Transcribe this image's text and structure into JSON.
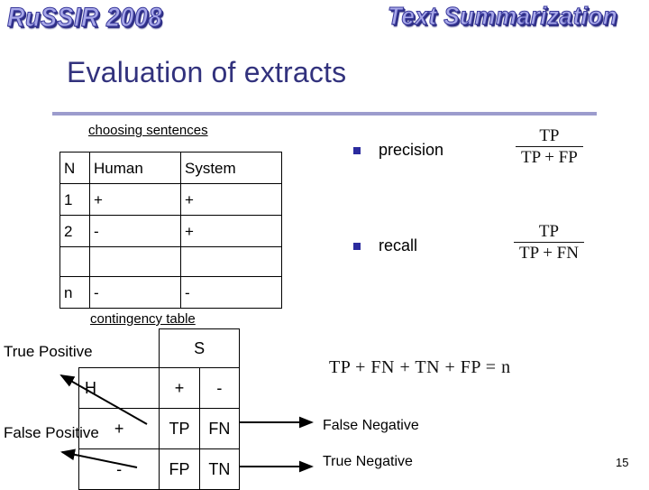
{
  "banner": {
    "left_text": "RuSSIR 2008",
    "right_text": "Text Summarization",
    "color": "#3a3a9c"
  },
  "title": {
    "text": "Evaluation of extracts",
    "color": "#32327d",
    "rule_color": "#9c9ccd"
  },
  "captions": {
    "choosing_sentences": "choosing sentences",
    "contingency_table": "contingency table"
  },
  "sentences_table": {
    "headers": [
      "N",
      "Human",
      "System"
    ],
    "rows": [
      [
        "1",
        "+",
        "+"
      ],
      [
        "2",
        "-",
        "+"
      ],
      [
        "",
        "",
        ""
      ],
      [
        "n",
        "-",
        "-"
      ]
    ]
  },
  "contingency_table": {
    "corner": "",
    "system_header": "S",
    "human_header": "H",
    "system_values": [
      "+",
      "-"
    ],
    "human_values": [
      "+",
      "-"
    ],
    "cells": [
      [
        "TP",
        "FN"
      ],
      [
        "FP",
        "TN"
      ]
    ]
  },
  "callouts": {
    "true_positive": "True Positive",
    "false_positive": "False Positive",
    "false_negative": "False Negative",
    "true_negative": "True Negative"
  },
  "metrics": [
    {
      "label": "precision",
      "numerator": "TP",
      "denominator": "TP + FP",
      "bullet_color": "#2b2b9e"
    },
    {
      "label": "recall",
      "numerator": "TP",
      "denominator": "TP + FN",
      "bullet_color": "#2b2b9e"
    }
  ],
  "equation": "TP + FN + TN + FP = n",
  "page_number": "15"
}
